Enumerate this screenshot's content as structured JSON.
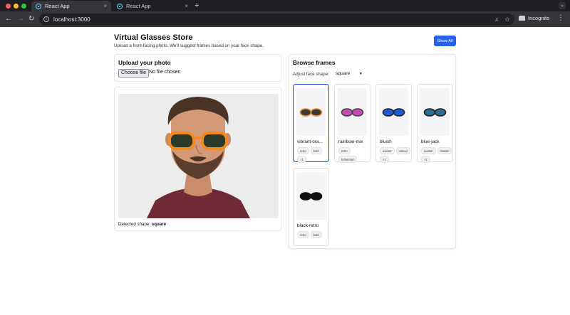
{
  "browser": {
    "tabs": [
      {
        "title": "React App",
        "close": "×",
        "active": true
      },
      {
        "title": "React App",
        "close": "×",
        "active": false
      }
    ],
    "new_tab": "+",
    "url": "localhost:3000",
    "profile_label": "Incognito"
  },
  "header": {
    "title": "Virtual Glasses Store",
    "subtitle": "Upload a front-facing photo. We'll suggest frames based on your face shape.",
    "show_all_label": "Show All"
  },
  "upload": {
    "title": "Upload your photo",
    "file_button": "Choose file",
    "file_status": "No file chosen"
  },
  "preview": {
    "detected_label": "Detected shape:",
    "detected_value": "square"
  },
  "browse": {
    "title": "Browse frames",
    "shape_label": "Adjust face shape:",
    "shape_value": "square",
    "frames": [
      {
        "name": "vibrant-ora...",
        "tags": [
          "retro",
          "bold",
          "+1"
        ],
        "lens": "#3a3a3a",
        "rim": "#f08a24",
        "selected": true
      },
      {
        "name": "rainbow-mix",
        "tags": [
          "retro",
          "bohemian"
        ],
        "lens": "#c94ab0",
        "rim": "#444444",
        "selected": false
      },
      {
        "name": "bluish",
        "tags": [
          "aviator",
          "casual",
          "+1"
        ],
        "lens": "#1e5bd8",
        "rim": "#222222",
        "selected": false
      },
      {
        "name": "blue-jack",
        "tags": [
          "aviator",
          "classic",
          "+1"
        ],
        "lens": "#2a6f8f",
        "rim": "#222222",
        "selected": false
      },
      {
        "name": "black-retro",
        "tags": [
          "retro",
          "bold"
        ],
        "lens": "#111111",
        "rim": "#111111",
        "selected": false
      }
    ]
  }
}
